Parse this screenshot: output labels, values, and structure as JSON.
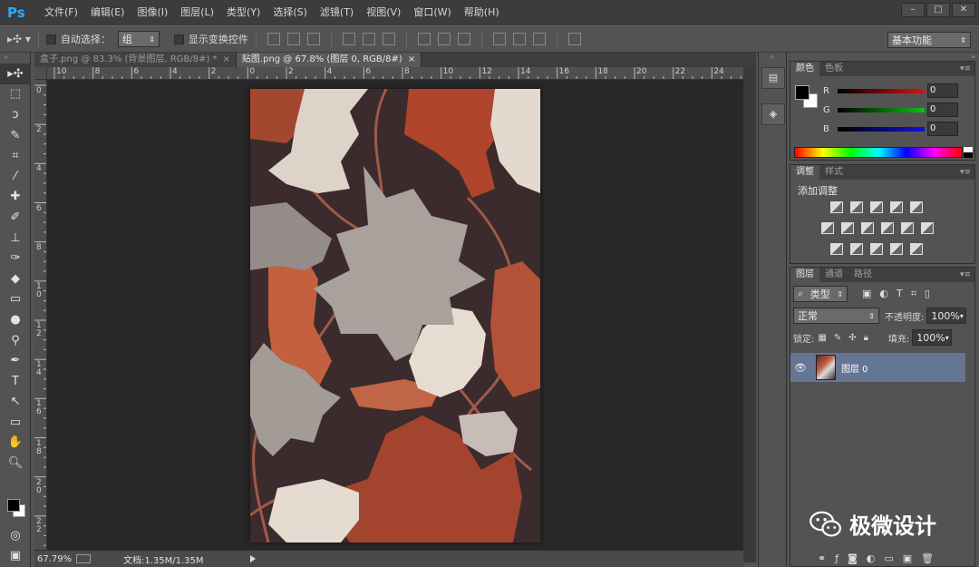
{
  "app": {
    "logo": "Ps",
    "menu": [
      "文件(F)",
      "编辑(E)",
      "图像(I)",
      "图层(L)",
      "类型(Y)",
      "选择(S)",
      "滤镜(T)",
      "视图(V)",
      "窗口(W)",
      "帮助(H)"
    ],
    "window_controls": [
      "minimize-icon",
      "maximize-icon",
      "close-icon"
    ]
  },
  "options": {
    "auto_select_label": "自动选择：",
    "auto_select_value": "组",
    "show_transform_label": "显示变换控件",
    "workspace": "基本功能"
  },
  "tabs": [
    {
      "label": "盒子.png @ 83.3% (背景图层, RGB/8#) *",
      "active": false
    },
    {
      "label": "贴图.png @ 67.8% (图层 0, RGB/8#)",
      "active": true
    }
  ],
  "tools": [
    "move-icon",
    "marquee-icon",
    "lasso-icon",
    "quick-select-icon",
    "crop-icon",
    "eyedropper-icon",
    "healing-icon",
    "brush-icon",
    "stamp-icon",
    "history-brush-icon",
    "eraser-icon",
    "gradient-icon",
    "blur-icon",
    "dodge-icon",
    "pen-icon",
    "type-icon",
    "path-select-icon",
    "shape-icon",
    "hand-icon",
    "zoom-icon"
  ],
  "ruler": {
    "top": [
      "10",
      "8",
      "6",
      "4",
      "2",
      "0",
      "2",
      "4",
      "6",
      "8",
      "10",
      "12",
      "14",
      "16",
      "18",
      "20",
      "22",
      "24"
    ],
    "left": [
      "0",
      "2",
      "4",
      "6",
      "8",
      "1\n0",
      "1\n2",
      "1\n4",
      "1\n6",
      "1\n8",
      "2\n0",
      "2\n2"
    ]
  },
  "status": {
    "zoom": "67.79%",
    "doc": "文档:1.35M/1.35M"
  },
  "color_panel": {
    "tabs": [
      "颜色",
      "色板"
    ],
    "channels": [
      {
        "name": "R",
        "value": "0",
        "color": "#e01010"
      },
      {
        "name": "G",
        "value": "0",
        "color": "#10c010"
      },
      {
        "name": "B",
        "value": "0",
        "color": "#1010e0"
      }
    ]
  },
  "adjustments_panel": {
    "tabs": [
      "调整",
      "样式"
    ],
    "title": "添加调整"
  },
  "layers_panel": {
    "tabs": [
      "图层",
      "通道",
      "路径"
    ],
    "filter_label": "类型",
    "blend_mode": "正常",
    "opacity_label": "不透明度:",
    "opacity_value": "100%",
    "lock_label": "锁定:",
    "fill_label": "填充:",
    "fill_value": "100%",
    "layers": [
      {
        "name": "图层 0",
        "visible": true,
        "selected": true
      }
    ]
  },
  "watermark": "极微设计"
}
